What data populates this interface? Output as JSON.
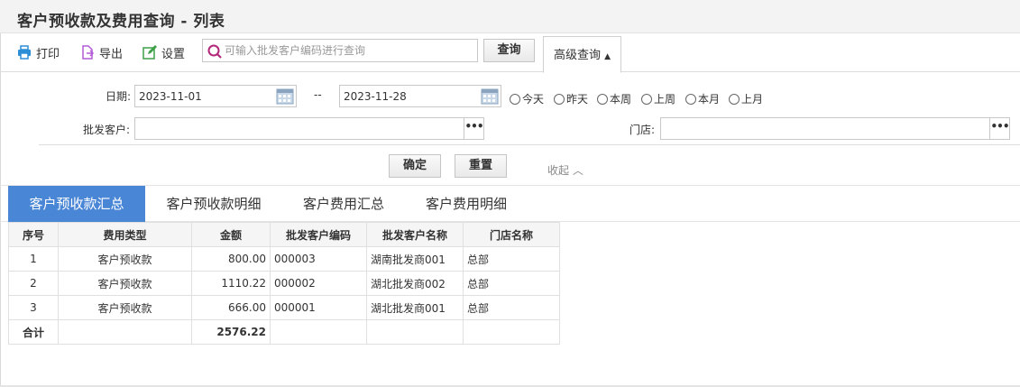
{
  "page": {
    "title": "客户预收款及费用查询 - 列表"
  },
  "toolbar": {
    "print_label": "打印",
    "export_label": "导出",
    "settings_label": "设置",
    "search_placeholder": "可输入批发客户编码进行查询",
    "search_value": "",
    "query_label": "查询",
    "advanced_label": "高级查询"
  },
  "filter": {
    "date_label": "日期:",
    "date_from": "2023-11-01",
    "date_sep": "--",
    "date_to": "2023-11-28",
    "quick_ranges": [
      "今天",
      "昨天",
      "本周",
      "上周",
      "本月",
      "上月"
    ],
    "customer_label": "批发客户:",
    "customer_value": "",
    "store_label": "门店:",
    "store_value": "",
    "confirm_label": "确定",
    "reset_label": "重置",
    "collapse_label": "收起"
  },
  "tabs": [
    "客户预收款汇总",
    "客户预收款明细",
    "客户费用汇总",
    "客户费用明细"
  ],
  "active_tab": 0,
  "table": {
    "columns": [
      "序号",
      "费用类型",
      "金额",
      "批发客户编码",
      "批发客户名称",
      "门店名称"
    ],
    "rows": [
      {
        "no": "1",
        "type": "客户预收款",
        "amount": "800.00",
        "code": "000003",
        "name": "湖南批发商001",
        "store": "总部"
      },
      {
        "no": "2",
        "type": "客户预收款",
        "amount": "1110.22",
        "code": "000002",
        "name": "湖北批发商002",
        "store": "总部"
      },
      {
        "no": "3",
        "type": "客户预收款",
        "amount": "666.00",
        "code": "000001",
        "name": "湖北批发商001",
        "store": "总部"
      }
    ],
    "total_label": "合计",
    "total_amount": "2576.22"
  },
  "colors": {
    "accent": "#4a86d6",
    "print_icon": "#2d8ed8",
    "export_icon": "#b15bd6",
    "settings_icon": "#3ca046",
    "search_icon": "#b3277b"
  }
}
